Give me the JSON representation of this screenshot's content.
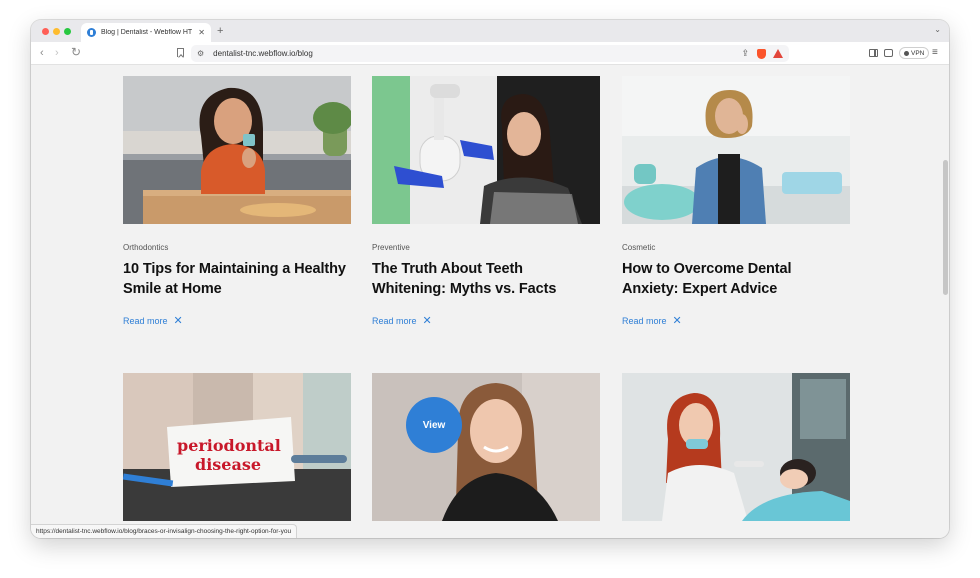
{
  "browser": {
    "tab_title": "Blog | Dentalist - Webflow HT",
    "url": "dentalist-tnc.webflow.io/blog",
    "vpn_label": "VPN",
    "status_url": "https://dentalist-tnc.webflow.io/blog/braces-or-invisalign-choosing-the-right-option-for-you"
  },
  "blog": {
    "read_more_label": "Read more",
    "view_label": "View",
    "posts": [
      {
        "category": "Orthodontics",
        "title": "10 Tips for Maintaining a Healthy Smile at Home"
      },
      {
        "category": "Preventive",
        "title": "The Truth About Teeth Whitening: Myths vs. Facts"
      },
      {
        "category": "Cosmetic",
        "title": "How to Overcome Dental Anxiety: Expert Advice"
      }
    ],
    "second_row_image_text": [
      "periodontal",
      "disease"
    ]
  },
  "colors": {
    "accent": "#2f7fd6",
    "page_background": "#f2f2f2"
  }
}
